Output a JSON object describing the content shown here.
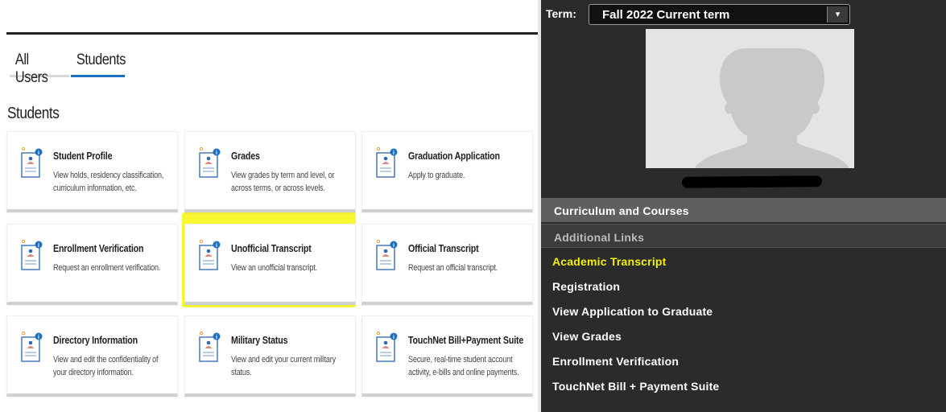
{
  "left": {
    "tabs": [
      {
        "label": "All Users",
        "active": false
      },
      {
        "label": "Students",
        "active": true
      }
    ],
    "section_title": "Students",
    "accent_color": "#1f6fc1",
    "highlight_color": "#f7f732",
    "cards": [
      {
        "title": "Student Profile",
        "description": "View holds, residency classification, curriculum information, etc."
      },
      {
        "title": "Grades",
        "description": "View grades by term and level, or across terms, or across levels."
      },
      {
        "title": "Graduation Application",
        "description": "Apply to graduate."
      },
      {
        "title": "Enrollment Verification",
        "description": "Request an enrollment verification."
      },
      {
        "title": "Unofficial Transcript",
        "description": "View an unofficial transcript.",
        "highlighted": true
      },
      {
        "title": "Official Transcript",
        "description": "Request an official transcript."
      },
      {
        "title": "Directory Information",
        "description": "View and edit the confidentiality of your directory information."
      },
      {
        "title": "Military Status",
        "description": "View and edit your current military status."
      },
      {
        "title": "TouchNet Bill+Payment Suite",
        "description": "Secure, real-time student account activity, e-bills and online payments."
      }
    ]
  },
  "right": {
    "term_label": "Term:",
    "term_value": "Fall 2022 Current term",
    "menu_current": "Curriculum and Courses",
    "menu_additional": "Additional Links",
    "links": [
      {
        "label": "Academic Transcript",
        "highlighted": true
      },
      {
        "label": "Registration"
      },
      {
        "label": "View Application to Graduate"
      },
      {
        "label": "View Grades"
      },
      {
        "label": "Enrollment Verification"
      },
      {
        "label": "TouchNet Bill + Payment Suite"
      }
    ],
    "highlight_text_color": "#f1f100"
  }
}
